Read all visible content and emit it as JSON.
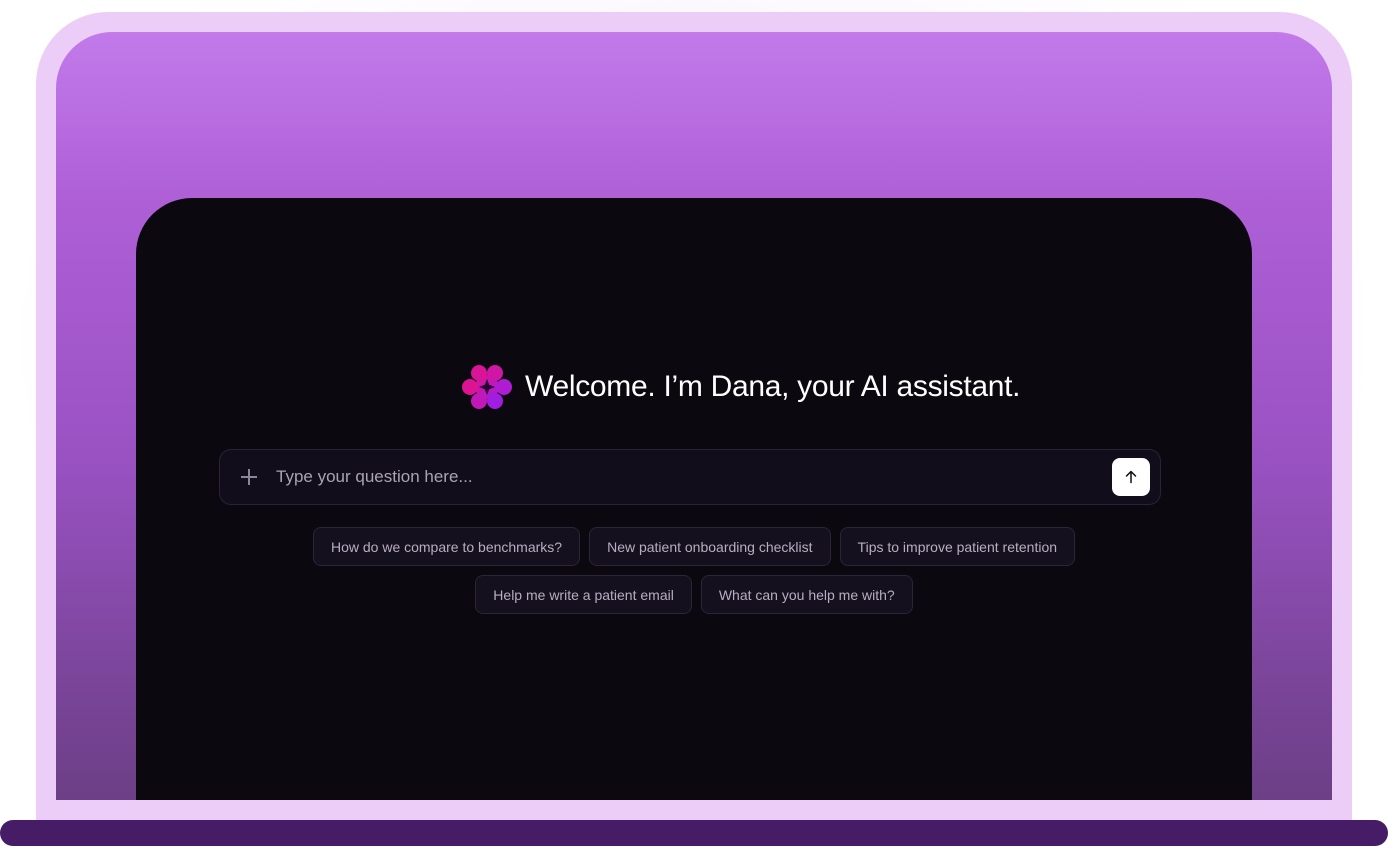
{
  "assistant": {
    "name": "Dana",
    "welcome": "Welcome. I’m Dana, your AI assistant.",
    "logo_icon": "flower-sparkle-icon"
  },
  "composer": {
    "value": "",
    "placeholder": "Type your question here...",
    "attach_icon": "plus-icon",
    "send_icon": "arrow-up-icon"
  },
  "suggestions": [
    "How do we compare to benchmarks?",
    "New patient onboarding checklist",
    "Tips to improve patient retention",
    "Help me write a patient email",
    "What can you help me with?"
  ],
  "colors": {
    "accent_magenta": "#e0138f",
    "accent_purple": "#a11ee0",
    "panel_background": "#0b0810",
    "screen_gradient_top": "#c27aea",
    "frame": "#eccdf8",
    "base": "#461c66"
  }
}
